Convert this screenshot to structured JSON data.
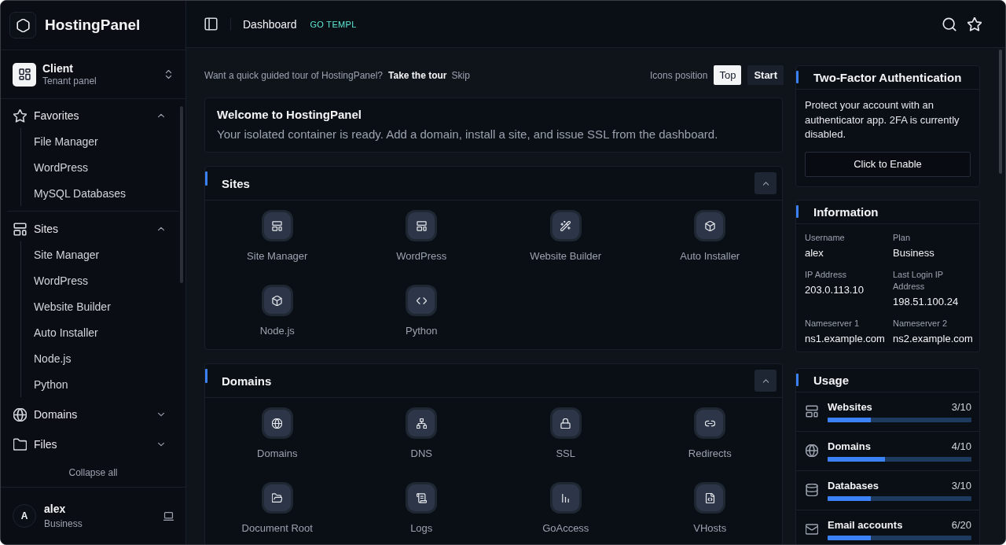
{
  "sidebar": {
    "brand": "HostingPanel",
    "switcher": {
      "title": "Client",
      "subtitle": "Tenant panel"
    },
    "favorites": {
      "label": "Favorites",
      "expanded": true,
      "items": [
        "File Manager",
        "WordPress",
        "MySQL Databases"
      ]
    },
    "nav_groups": [
      {
        "label": "Sites",
        "expanded": true,
        "items": [
          "Site Manager",
          "WordPress",
          "Website Builder",
          "Auto Installer",
          "Node.js",
          "Python"
        ]
      },
      {
        "label": "Domains",
        "expanded": false
      },
      {
        "label": "Files",
        "expanded": false
      }
    ],
    "collapse_all": "Collapse all",
    "user": {
      "initial": "A",
      "name": "alex",
      "plan": "Business"
    }
  },
  "topbar": {
    "page": "Dashboard",
    "badge": "GO TEMPL"
  },
  "tour": {
    "prompt": "Want a quick guided tour of HostingPanel?",
    "action": "Take the tour",
    "dismiss": "Skip",
    "position_label": "Icons position",
    "positions": [
      {
        "label": "Top",
        "selected": true
      }
    ],
    "start": "Start"
  },
  "welcome": {
    "title": "Welcome to HostingPanel",
    "text": "Your isolated container is ready. Add a domain, install a site, and issue SSL from the dashboard."
  },
  "sections": [
    {
      "title": "Sites",
      "expanded": true,
      "items": [
        "Site Manager",
        "WordPress",
        "Website Builder",
        "Auto Installer",
        "Node.js",
        "Python"
      ]
    },
    {
      "title": "Domains",
      "expanded": true,
      "items": [
        "Domains",
        "DNS",
        "SSL",
        "Redirects",
        "Document Root",
        "Logs",
        "GoAccess",
        "VHosts"
      ]
    }
  ],
  "two_factor": {
    "title": "Two-Factor Authentication",
    "text": "Protect your account with an authenticator app. 2FA is currently disabled.",
    "button": "Click to Enable"
  },
  "information": {
    "title": "Information",
    "fields": [
      {
        "label": "Username",
        "value": "alex"
      },
      {
        "label": "Plan",
        "value": "Business"
      },
      {
        "label": "IP Address",
        "value": "203.0.113.10"
      },
      {
        "label": "Last Login IP Address",
        "value": "198.51.100.24"
      },
      {
        "label": "Nameserver 1",
        "value": "ns1.example.com"
      },
      {
        "label": "Nameserver 2",
        "value": "ns2.example.com"
      }
    ]
  },
  "usage": {
    "title": "Usage",
    "items": [
      {
        "name": "Websites",
        "reading": "3/10",
        "level": 0.3
      },
      {
        "name": "Domains",
        "reading": "4/10",
        "level": 0.4
      },
      {
        "name": "Databases",
        "reading": "3/10",
        "level": 0.3
      },
      {
        "name": "Email accounts",
        "reading": "6/20",
        "level": 0.3
      }
    ]
  }
}
